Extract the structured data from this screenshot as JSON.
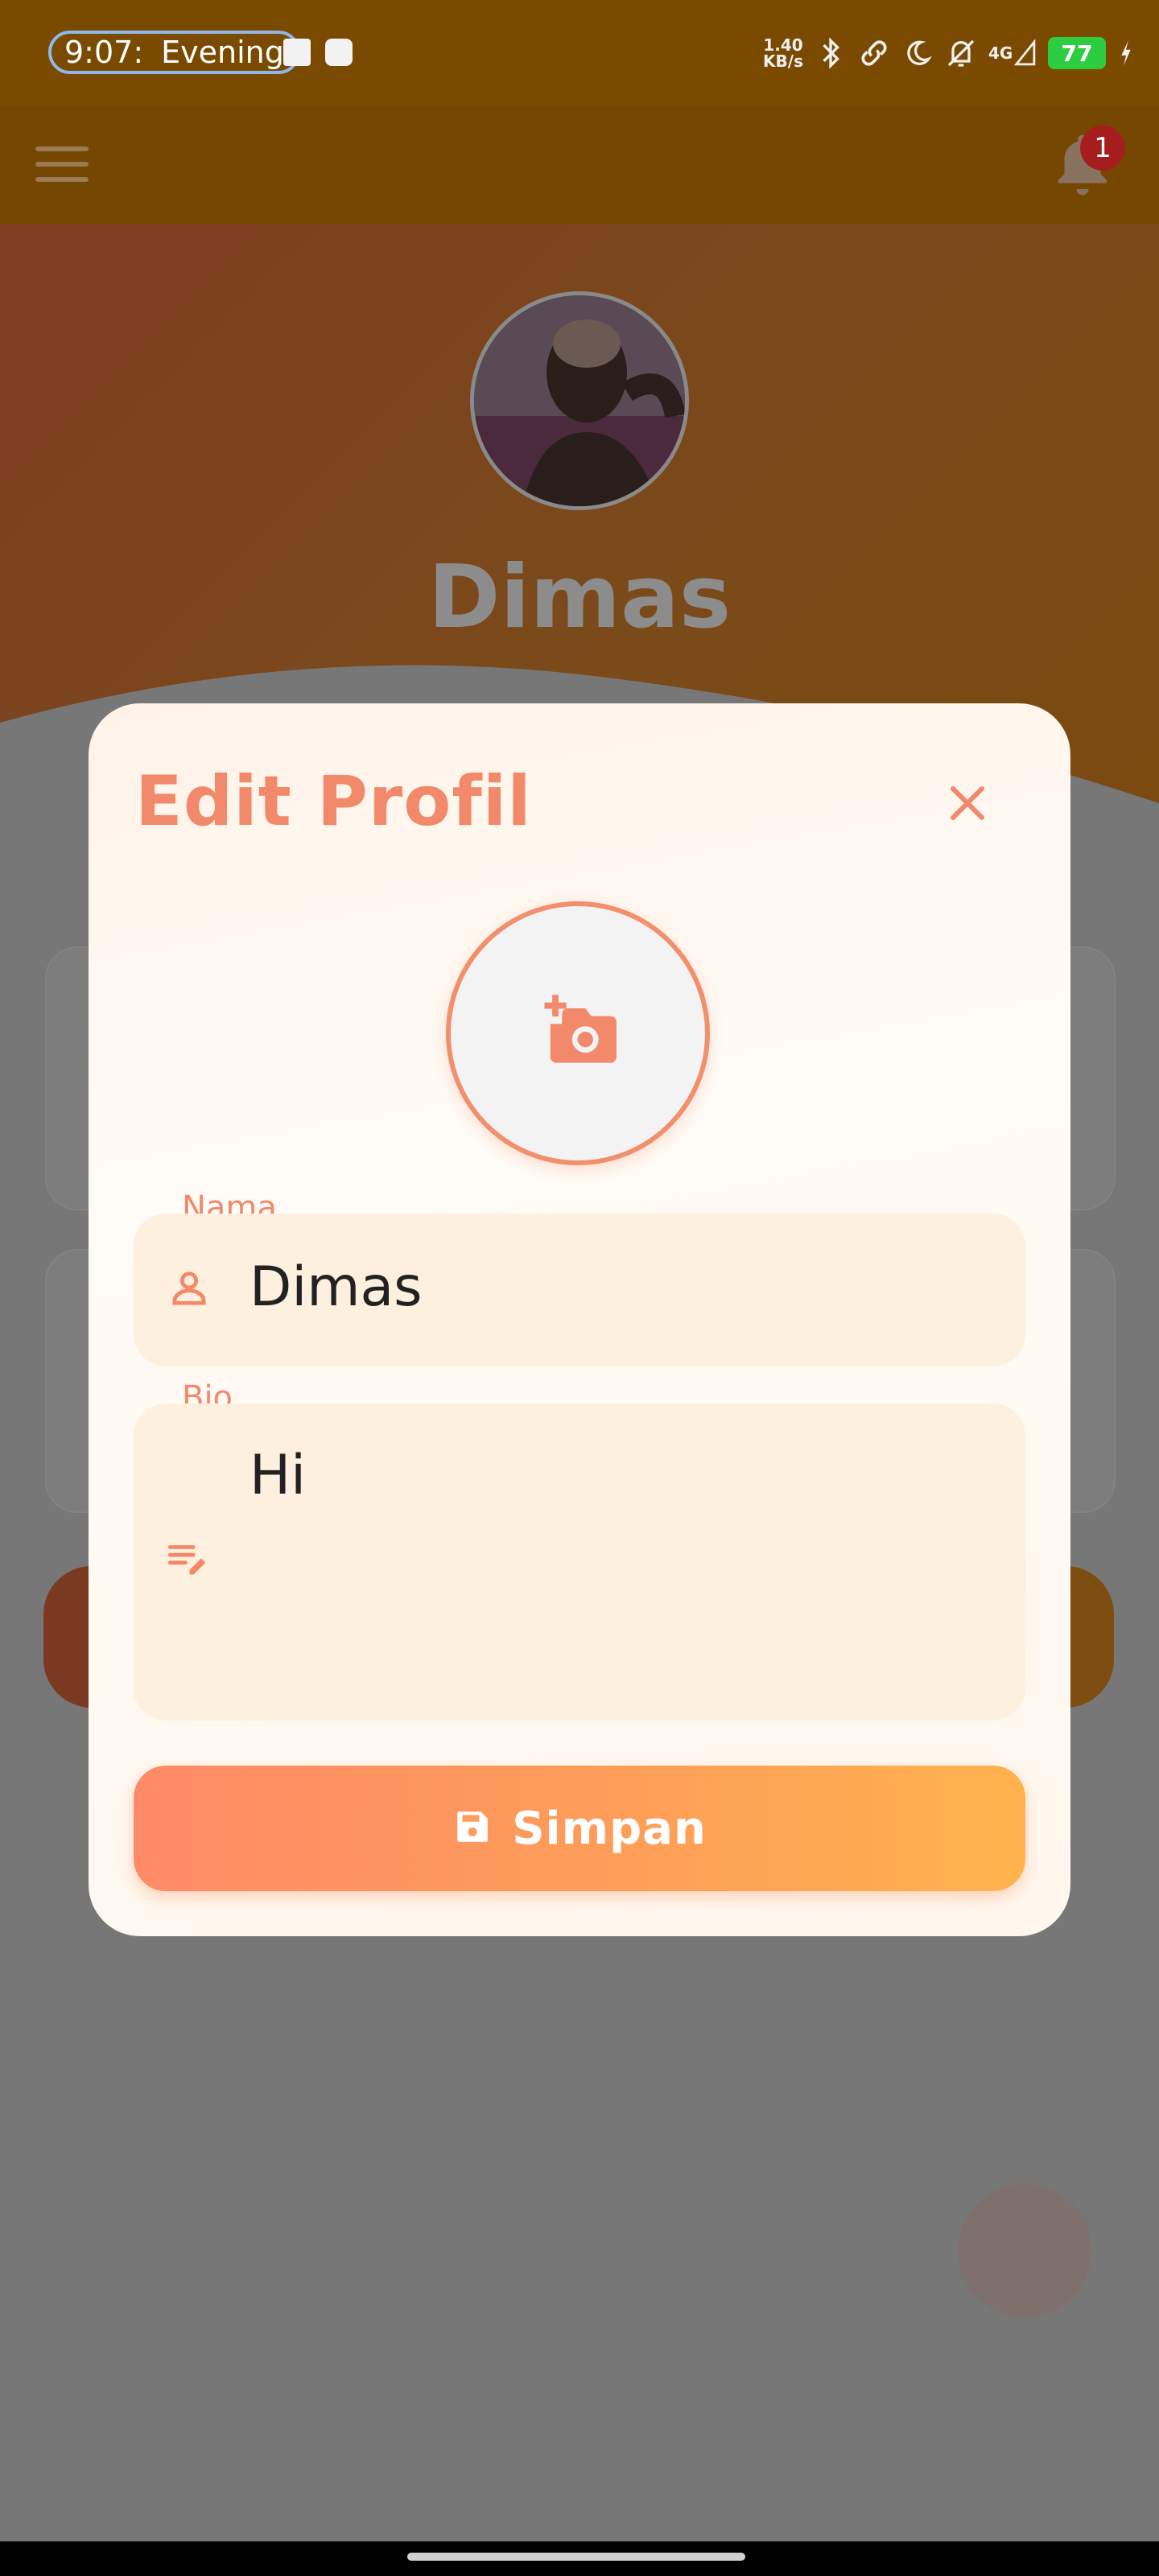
{
  "status_bar": {
    "time": "9:07:",
    "period": "Evening",
    "net_speed_value": "1.40",
    "net_speed_unit": "KB/s",
    "network": "4G",
    "battery": "77"
  },
  "app_bar": {
    "notification_count": "1"
  },
  "profile": {
    "name": "Dimas"
  },
  "dialog": {
    "title": "Edit Profil",
    "name_field": {
      "label": "Nama",
      "value": "Dimas"
    },
    "bio_field": {
      "label": "Bio",
      "value": "Hi"
    },
    "save_label": "Simpan"
  },
  "colors": {
    "accent": "#f2896a",
    "field_bg": "#fef0de",
    "button_start": "#ff8a68",
    "button_end": "#ffb24e"
  }
}
